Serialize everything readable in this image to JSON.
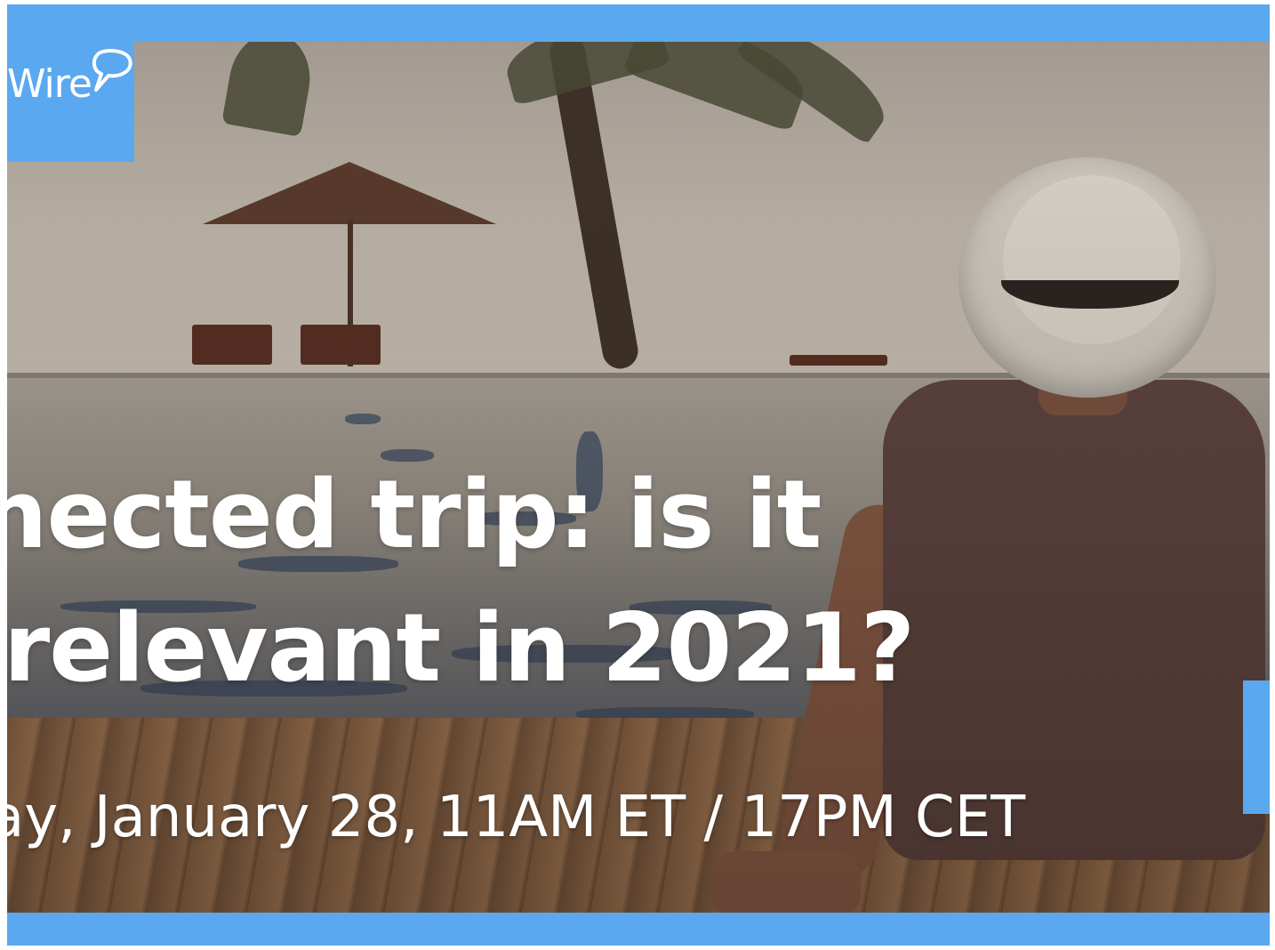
{
  "logo": {
    "text": "Wire",
    "icon": "speech-bubble-icon"
  },
  "title": {
    "line1": "nected trip: is it",
    "line2": "relevant in 2021?"
  },
  "event": {
    "date_time": "ay, January 28, 11AM ET / 17PM CET"
  },
  "colors": {
    "brand_blue": "#5aa8f0",
    "text": "#ffffff"
  }
}
